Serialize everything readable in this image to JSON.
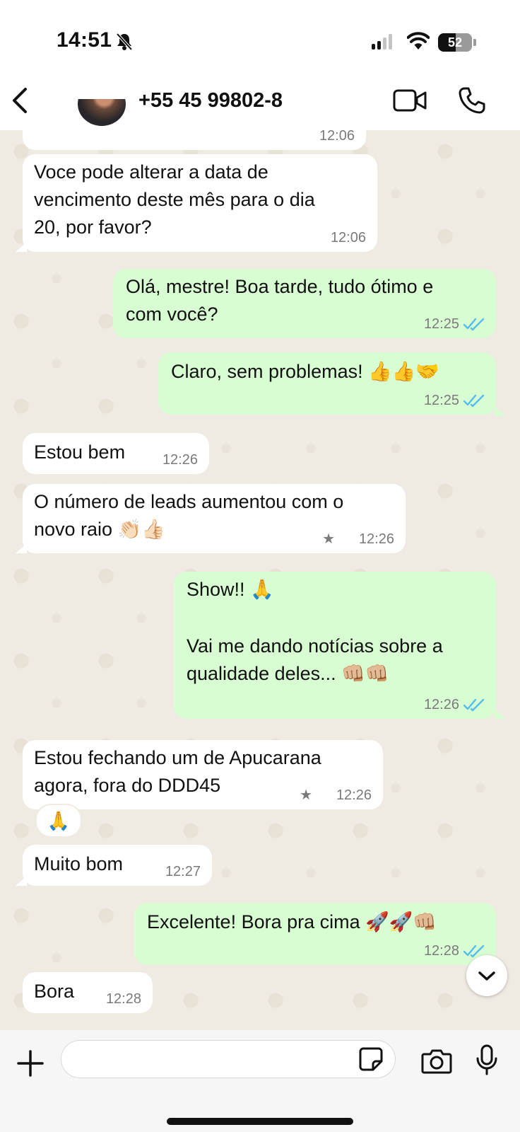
{
  "status_bar": {
    "time": "14:51",
    "battery": "52",
    "battery_level": 0.52
  },
  "header": {
    "contact_name": "+55 45 99802-8"
  },
  "messages": [
    {
      "dir": "in",
      "time": "12:06"
    },
    {
      "dir": "in",
      "lines": [
        "Voce pode alterar a data de",
        "vencimento deste mês para o dia",
        "20, por favor?"
      ],
      "time": "12:06"
    },
    {
      "dir": "out",
      "lines": [
        "Olá, mestre! Boa tarde, tudo ótimo e",
        "com você?"
      ],
      "time": "12:25",
      "read": true
    },
    {
      "dir": "out",
      "lines": [
        "Claro, sem problemas! 👍👍🤝"
      ],
      "time": "12:25",
      "read": true
    },
    {
      "dir": "in",
      "lines": [
        "Estou bem"
      ],
      "time": "12:26"
    },
    {
      "dir": "in",
      "lines": [
        "O número de leads aumentou com o",
        "novo raio 👏🏻👍🏻"
      ],
      "time": "12:26",
      "starred": true
    },
    {
      "dir": "out",
      "lines": [
        "Show!! 🙏",
        "",
        "Vai me dando notícias sobre a",
        "qualidade deles... 👊🏼👊🏼"
      ],
      "time": "12:26",
      "read": true
    },
    {
      "dir": "in",
      "lines": [
        "Estou fechando um de Apucarana",
        "agora, fora do DDD45"
      ],
      "time": "12:26",
      "starred": true,
      "reaction": "🙏"
    },
    {
      "dir": "in",
      "lines": [
        "Muito bom"
      ],
      "time": "12:27"
    },
    {
      "dir": "out",
      "lines": [
        "Excelente! Bora pra cima 🚀🚀👊🏼"
      ],
      "time": "12:28",
      "read": true
    },
    {
      "dir": "in",
      "lines": [
        "Bora"
      ],
      "time": "12:28"
    }
  ],
  "input": {
    "placeholder": ""
  },
  "icons": {
    "bell": "bell-slash-icon",
    "signal": "signal-icon",
    "wifi": "wifi-icon",
    "back": "chevron-left-icon",
    "video": "video-camera-icon",
    "phone": "phone-icon",
    "plus": "plus-icon",
    "sticker": "sticker-icon",
    "camera": "camera-icon",
    "mic": "microphone-icon",
    "scroll": "chevron-down-icon",
    "tick": "double-check-icon"
  },
  "colors": {
    "incoming_bubble": "#ffffff",
    "outgoing_bubble": "#d9fdd3",
    "read_tick": "#53bdeb",
    "chat_background": "#efeae2"
  }
}
